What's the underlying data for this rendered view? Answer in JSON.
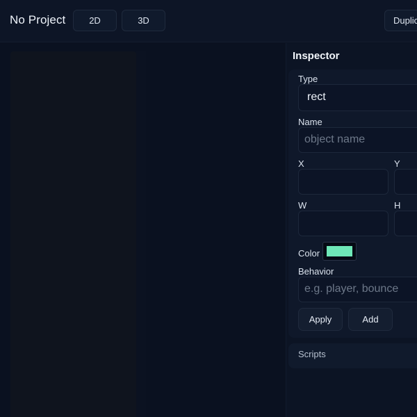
{
  "header": {
    "project_title": "No Project",
    "mode_2d_label": "2D",
    "mode_3d_label": "3D",
    "duplicate_label": "Duplic"
  },
  "inspector": {
    "title": "Inspector",
    "type_label": "Type",
    "type_value": "rect",
    "name_label": "Name",
    "name_placeholder": "object name",
    "x_label": "X",
    "y_label": "Y",
    "w_label": "W",
    "h_label": "H",
    "color_label": "Color",
    "color_value": "#6ee7b7",
    "behavior_label": "Behavior",
    "behavior_placeholder": "e.g. player, bounce",
    "apply_label": "Apply",
    "add_label": "Add",
    "scripts_label": "Scripts"
  }
}
